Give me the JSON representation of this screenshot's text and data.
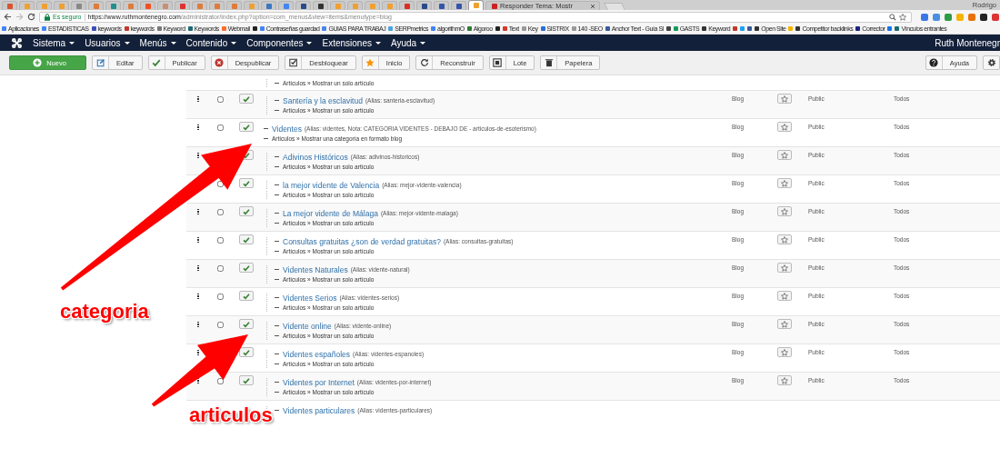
{
  "browser": {
    "tabs": [
      {
        "selected": false,
        "color": "#d9532c"
      },
      {
        "selected": false,
        "color": "#f0a030"
      },
      {
        "selected": false,
        "color": "#f0a030"
      },
      {
        "selected": false,
        "color": "#f0a030"
      },
      {
        "selected": false,
        "color": "#888888"
      },
      {
        "selected": false,
        "color": "#e07b39"
      },
      {
        "selected": false,
        "color": "#1f8f8f"
      },
      {
        "selected": false,
        "color": "#e07b39"
      },
      {
        "selected": false,
        "color": "#f25022"
      },
      {
        "selected": false,
        "color": "#c79070"
      },
      {
        "selected": false,
        "color": "#e03030"
      },
      {
        "selected": false,
        "color": "#e07b39"
      },
      {
        "selected": false,
        "color": "#e07b39"
      },
      {
        "selected": false,
        "color": "#e07b39"
      },
      {
        "selected": false,
        "color": "#f0a030"
      },
      {
        "selected": false,
        "color": "#3a78c2"
      },
      {
        "selected": false,
        "color": "#4285f4"
      },
      {
        "selected": false,
        "color": "#2a4a8a"
      },
      {
        "selected": false,
        "color": "#333333"
      },
      {
        "selected": false,
        "color": "#f0a030"
      },
      {
        "selected": false,
        "color": "#f0a030"
      },
      {
        "selected": false,
        "color": "#f0a030"
      },
      {
        "selected": false,
        "color": "#f0a030"
      },
      {
        "selected": false,
        "color": "#d93025"
      },
      {
        "selected": false,
        "color": "#2a4a8a"
      },
      {
        "selected": false,
        "color": "#3355aa"
      },
      {
        "selected": false,
        "color": "#3355aa"
      },
      {
        "selected": true,
        "color": "#f0a030"
      },
      {
        "selected": false,
        "color": "#cc2222",
        "title": "Responder Tema: Mostr"
      }
    ],
    "profile": "Rodrigo",
    "secure_label": "Es seguro",
    "url_host": "https://www.ruthmontenegro.com",
    "url_path": "/administrator/index.php?option=com_menus&view=items&menutype=blog",
    "bookmarks": [
      {
        "kind": "link",
        "label": "Aplicaciones"
      },
      {
        "kind": "link",
        "label": "ESTADISTICAS"
      },
      {
        "kind": "link",
        "label": "keywords"
      },
      {
        "kind": "link",
        "label": "keywords"
      },
      {
        "kind": "link",
        "label": "Keyword"
      },
      {
        "kind": "link",
        "label": "Keywords"
      },
      {
        "kind": "link",
        "label": "Webmail"
      },
      {
        "kind": "icon"
      },
      {
        "kind": "link",
        "label": "Contraseñas guardad"
      },
      {
        "kind": "link",
        "label": "GUIAS PARA TRABAJ"
      },
      {
        "kind": "link",
        "label": "SERPmetrics"
      },
      {
        "kind": "link",
        "label": "algorithmO"
      },
      {
        "kind": "link",
        "label": "Algoroo"
      },
      {
        "kind": "icon"
      },
      {
        "kind": "link",
        "label": "Text"
      },
      {
        "kind": "link",
        "label": "Key"
      },
      {
        "kind": "link",
        "label": "SISTRIX"
      },
      {
        "kind": "link",
        "label": "140 -SEO"
      },
      {
        "kind": "link",
        "label": "Anchor Text - Guía Sl"
      },
      {
        "kind": "icon"
      },
      {
        "kind": "link",
        "label": "GASTS"
      },
      {
        "kind": "link",
        "label": "Keyword"
      },
      {
        "kind": "icon"
      },
      {
        "kind": "icon"
      },
      {
        "kind": "icon"
      },
      {
        "kind": "link",
        "label": "Open Site"
      },
      {
        "kind": "icon"
      },
      {
        "kind": "link",
        "label": "Competitor backlinks"
      },
      {
        "kind": "link",
        "label": "Corrector"
      },
      {
        "kind": "icon"
      },
      {
        "kind": "link",
        "label": "Vínculos entrantes"
      }
    ]
  },
  "navbar": {
    "menus": [
      "Sistema",
      "Usuarios",
      "Menús",
      "Contenido",
      "Componentes",
      "Extensiones",
      "Ayuda"
    ],
    "user": "Ruth Montenegr"
  },
  "toolbar": {
    "left": [
      {
        "kind": "primary",
        "label": "Nuevo"
      },
      {
        "kind": "normal",
        "label": "Editar"
      },
      {
        "kind": "normal",
        "label": "Publicar"
      },
      {
        "kind": "normal",
        "label": "Despublicar"
      },
      {
        "kind": "normal",
        "label": "Desbloquear"
      },
      {
        "kind": "normal",
        "label": "Inicio"
      },
      {
        "kind": "normal",
        "label": "Reconstruir"
      },
      {
        "kind": "normal",
        "label": "Lote"
      },
      {
        "kind": "normal",
        "label": "Papelera"
      }
    ],
    "right": [
      {
        "kind": "normal",
        "label": "Ayuda"
      },
      {
        "kind": "normal"
      }
    ]
  },
  "menu_items": [
    {
      "kind": "hidden",
      "children": [
        {
          "kind": "partial",
          "type": "Artículos » Mostrar un solo artículo"
        },
        {
          "kind": "item",
          "title": "Santería y la esclavitud",
          "details": "(Alias: santeria-esclavitud)",
          "type": "Artículos » Mostrar un solo artículo",
          "checked": false,
          "published": true,
          "menu": "Blog",
          "home": false,
          "access": "Public",
          "language": "Todos"
        }
      ]
    },
    {
      "kind": "item",
      "title": "Videntes",
      "details": "(Alias: videntes, Nota: CATEGORIA VIDENTES - DEBAJO DE - articulos-de-esoterismo)",
      "type": "Artículos » Mostrar una categoría en formato blog",
      "checked": false,
      "published": true,
      "menu": "Blog",
      "home": false,
      "access": "Public",
      "language": "Todos",
      "children": [
        {
          "kind": "item",
          "title": "Adivinos Históricos",
          "details": "(Alias: adivinos-historicos)",
          "type": "Artículos » Mostrar un solo artículo",
          "published": true,
          "menu": "Blog",
          "home": false,
          "access": "Public",
          "language": "Todos"
        },
        {
          "kind": "item",
          "title": "la mejor vidente de Valencia",
          "details": "(Alias: mejor-vidente-valencia)",
          "type": "Artículos » Mostrar un solo artículo",
          "checked": false,
          "published": true,
          "menu": "Blog",
          "home": false,
          "access": "Public",
          "language": "Todos"
        },
        {
          "kind": "item",
          "title": "La mejor vidente de Málaga",
          "details": "(Alias: mejor-vidente-malaga)",
          "type": "Artículos » Mostrar un solo artículo",
          "checked": false,
          "published": true,
          "menu": "Blog",
          "home": false,
          "access": "Public",
          "language": "Todos"
        },
        {
          "kind": "item",
          "title": "Consultas gratuitas ¿son de verdad gratuitas?",
          "details": "(Alias: consultas-gratuitas)",
          "type": "Artículos » Mostrar un solo artículo",
          "checked": false,
          "published": true,
          "menu": "Blog",
          "home": false,
          "access": "Public",
          "language": "Todos"
        },
        {
          "kind": "item",
          "title": "Videntes Naturales",
          "details": "(Alias: vidente-natural)",
          "type": "Artículos » Mostrar un solo artículo",
          "checked": false,
          "published": true,
          "menu": "Blog",
          "home": false,
          "access": "Public",
          "language": "Todos"
        },
        {
          "kind": "item",
          "title": "Videntes Serios",
          "details": "(Alias: videntes-serios)",
          "type": "Artículos » Mostrar un solo artículo",
          "checked": false,
          "published": true,
          "menu": "Blog",
          "home": false,
          "access": "Public",
          "language": "Todos"
        },
        {
          "kind": "item",
          "title": "Vidente online",
          "details": "(Alias: vidente-online)",
          "type": "Artículos » Mostrar un solo artículo",
          "checked": false,
          "published": true,
          "menu": "Blog",
          "home": false,
          "access": "Public",
          "language": "Todos"
        },
        {
          "kind": "item",
          "title": "Videntes españoles",
          "details": "(Alias: videntes-espanoles)",
          "type": "Artículos » Mostrar un solo artículo",
          "published": true,
          "menu": "Blog",
          "home": false,
          "access": "Public",
          "language": "Todos"
        },
        {
          "kind": "item",
          "title": "Videntes por Internet",
          "details": "(Alias: videntes-por-internet)",
          "type": "Artículos » Mostrar un solo artículo",
          "checked": false,
          "published": true,
          "menu": "Blog",
          "home": false,
          "access": "Public",
          "language": "Todos"
        },
        {
          "kind": "item",
          "title": "Videntes particulares",
          "details": "(Alias: videntes-particulares)"
        }
      ]
    }
  ],
  "annotations": [
    {
      "label": "categoria"
    },
    {
      "label": "articulos"
    }
  ]
}
